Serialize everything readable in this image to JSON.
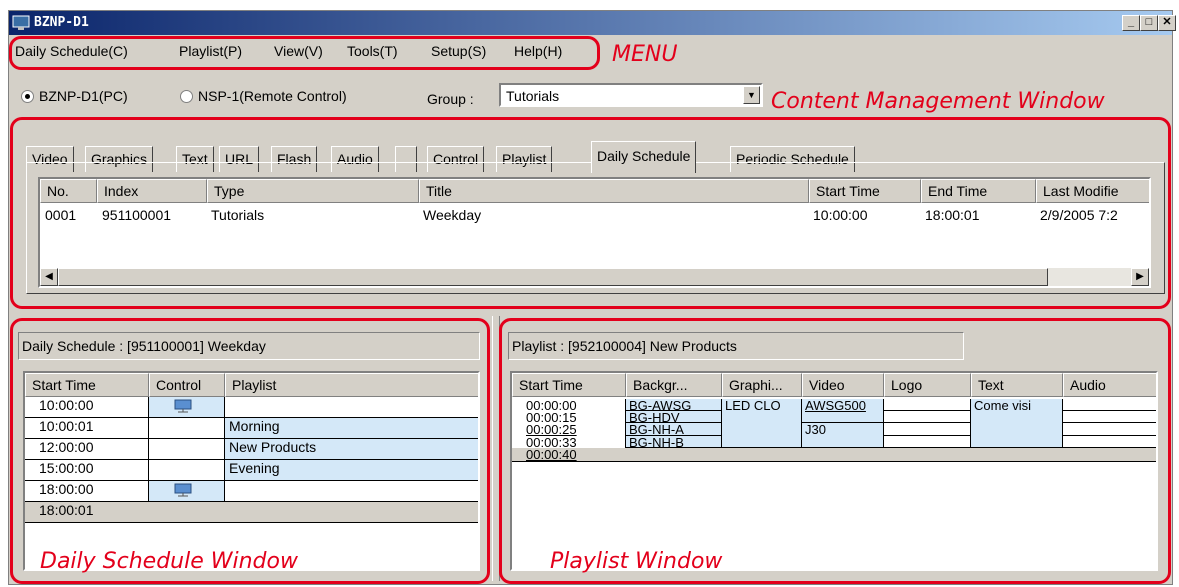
{
  "window": {
    "title": "BZNP-D1"
  },
  "menu": {
    "items": [
      "Daily Schedule(C)",
      "Playlist(P)",
      "View(V)",
      "Tools(T)",
      "Setup(S)",
      "Help(H)"
    ]
  },
  "mode": {
    "option1": "BZNP-D1(PC)",
    "option2": "NSP-1(Remote Control)",
    "selected": "BZNP-D1(PC)",
    "group_label": "Group :",
    "group_value": "Tutorials"
  },
  "annotations": {
    "menu": "MENU",
    "content": "Content Management Window",
    "daily": "Daily Schedule Window",
    "playlist": "Playlist Window",
    "color": "#e3001b"
  },
  "tabs": [
    "Video",
    "Graphics",
    "Text",
    "URL",
    "Flash",
    "Audio",
    "",
    "Control",
    "Playlist",
    "Daily Schedule",
    "Periodic Schedule"
  ],
  "active_tab": "Daily Schedule",
  "content_list": {
    "columns": [
      "No.",
      "Index",
      "Type",
      "Title",
      "Start Time",
      "End Time",
      "Last Modifie"
    ],
    "rows": [
      [
        "0001",
        "951100001",
        "Tutorials",
        "Weekday",
        "10:00:00",
        "18:00:01",
        "2/9/2005 7:2"
      ]
    ]
  },
  "daily_schedule": {
    "caption": "Daily Schedule : [951100001] Weekday",
    "columns": [
      "Start Time",
      "Control",
      "Playlist"
    ],
    "rows": [
      {
        "time": "10:00:00",
        "control": "monitor-icon",
        "playlist": ""
      },
      {
        "time": "10:00:01",
        "control": "",
        "playlist": "Morning"
      },
      {
        "time": "12:00:00",
        "control": "",
        "playlist": "New Products"
      },
      {
        "time": "15:00:00",
        "control": "",
        "playlist": "Evening"
      },
      {
        "time": "18:00:00",
        "control": "monitor-icon",
        "playlist": ""
      },
      {
        "time": "18:00:01",
        "control": "",
        "playlist": ""
      }
    ]
  },
  "playlist": {
    "caption": "Playlist : [952100004] New Products",
    "columns": [
      "Start Time",
      "Backgr...",
      "Graphi...",
      "Video",
      "Logo",
      "Text",
      "Audio"
    ],
    "times": [
      "00:00:00",
      "00:00:15",
      "00:00:25",
      "00:00:33",
      "00:00:40"
    ],
    "background": [
      "BG-AWSG",
      "BG-HDV",
      "BG-NH-A",
      "BG-NH-B"
    ],
    "graphics": "LED  CLO",
    "video": [
      "AWSG500",
      "J30"
    ],
    "text": "Come visi"
  },
  "colors": {
    "highlight": "#d4e8f8",
    "titlebar_start": "#0a246a",
    "titlebar_end": "#a6caf0"
  }
}
